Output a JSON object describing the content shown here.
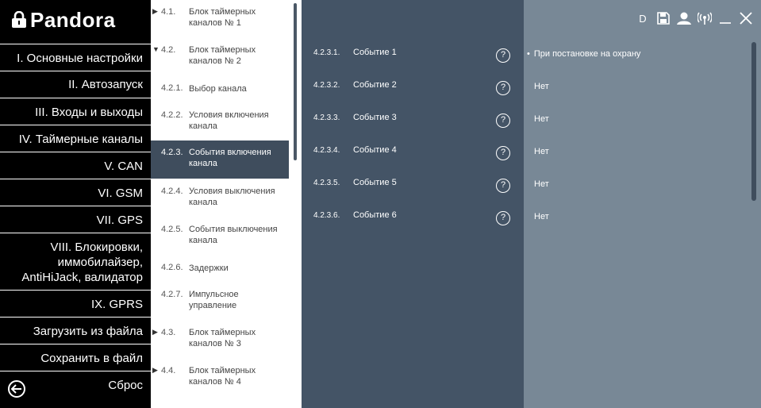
{
  "logo": {
    "text": "Pandora"
  },
  "sidebar": {
    "items": [
      {
        "label": "I. Основные настройки"
      },
      {
        "label": "II. Автозапуск"
      },
      {
        "label": "III. Входы и выходы"
      },
      {
        "label": "IV. Таймерные каналы"
      },
      {
        "label": "V. CAN"
      },
      {
        "label": "VI. GSM"
      },
      {
        "label": "VII. GPS"
      },
      {
        "label": "VIII. Блокировки, иммобилайзер, AntiHiJack, валидатор"
      },
      {
        "label": "IX. GPRS"
      },
      {
        "label": "Загрузить из файла"
      },
      {
        "label": "Сохранить в файл"
      },
      {
        "label": "Сброс"
      }
    ]
  },
  "tree": {
    "nodes": [
      {
        "num": "4.1.",
        "label": "Блок таймерных каналов № 1",
        "arrow": "▶"
      },
      {
        "num": "4.2.",
        "label": "Блок таймерных каналов № 2",
        "arrow": "▼"
      },
      {
        "num": "4.2.1.",
        "label": "Выбор канала",
        "arrow": ""
      },
      {
        "num": "4.2.2.",
        "label": "Условия включения канала",
        "arrow": ""
      },
      {
        "num": "4.2.3.",
        "label": "События включения канала",
        "arrow": ""
      },
      {
        "num": "4.2.4.",
        "label": "Условия выключения канала",
        "arrow": ""
      },
      {
        "num": "4.2.5.",
        "label": "События выключения канала",
        "arrow": ""
      },
      {
        "num": "4.2.6.",
        "label": "Задержки",
        "arrow": ""
      },
      {
        "num": "4.2.7.",
        "label": "Импульсное управление",
        "arrow": ""
      },
      {
        "num": "4.3.",
        "label": "Блок таймерных каналов № 3",
        "arrow": "▶"
      },
      {
        "num": "4.4.",
        "label": "Блок таймерных каналов № 4",
        "arrow": "▶"
      }
    ]
  },
  "events": [
    {
      "num": "4.2.3.1.",
      "label": "Событие 1",
      "help": "?",
      "value": "При постановке на охрану",
      "bullet": "•"
    },
    {
      "num": "4.2.3.2.",
      "label": "Событие 2",
      "help": "?",
      "value": "Нет"
    },
    {
      "num": "4.2.3.3.",
      "label": "Событие 3",
      "help": "?",
      "value": "Нет"
    },
    {
      "num": "4.2.3.4.",
      "label": "Событие 4",
      "help": "?",
      "value": "Нет"
    },
    {
      "num": "4.2.3.5.",
      "label": "Событие 5",
      "help": "?",
      "value": "Нет"
    },
    {
      "num": "4.2.3.6.",
      "label": "Событие 6",
      "help": "?",
      "value": "Нет"
    }
  ],
  "toolbar": {
    "d_label": "D"
  },
  "colors": {
    "tree_active": "#3f4d5d",
    "mid_bg": "#445466",
    "right_bg": "#788896"
  }
}
